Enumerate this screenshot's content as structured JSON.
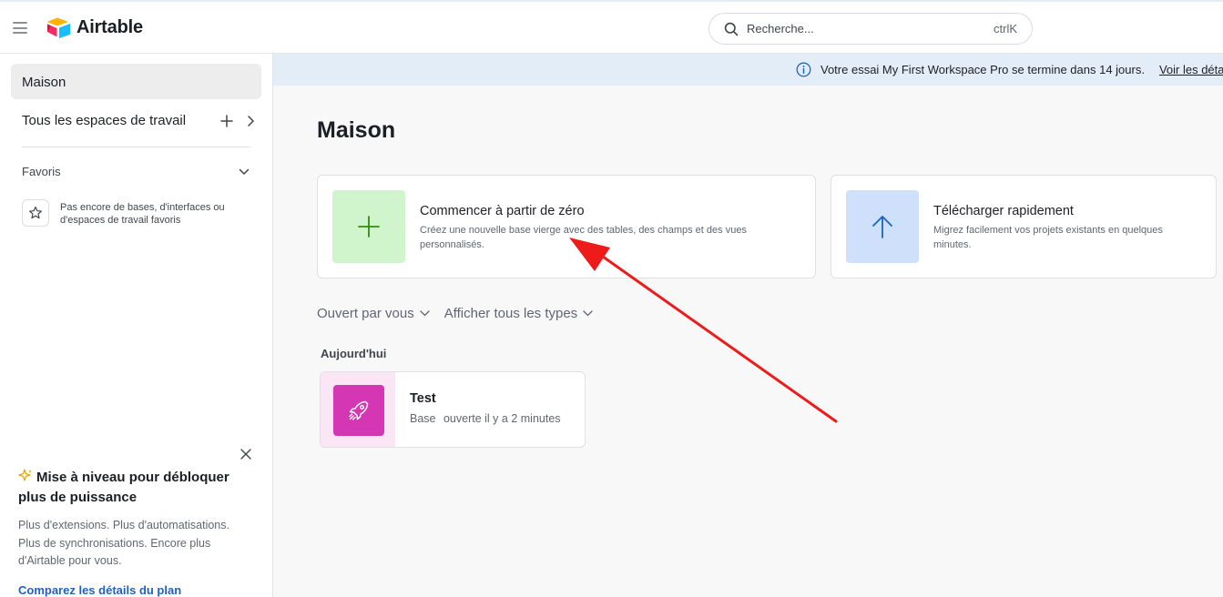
{
  "header": {
    "app_name": "Airtable",
    "search_placeholder": "Recherche...",
    "search_shortcut": "ctrlK"
  },
  "sidebar": {
    "home": "Maison",
    "workspaces": "Tous les espaces de travail",
    "favorites_title": "Favoris",
    "favorites_empty": "Pas encore de bases, d'interfaces ou d'espaces de travail favoris",
    "upgrade": {
      "title": "Mise à niveau pour débloquer plus de puissance",
      "description": "Plus d'extensions. Plus d'automatisations. Plus de synchronisations. Encore plus d'Airtable pour vous.",
      "link": "Comparez les détails du plan"
    }
  },
  "banner": {
    "text": "Votre essai My First Workspace Pro se termine dans 14 jours.",
    "link": "Voir les détails"
  },
  "main": {
    "title": "Maison",
    "cards": [
      {
        "title": "Commencer à partir de zéro",
        "description": "Créez une nouvelle base vierge avec des tables, des champs et des vues personnalisés.",
        "icon": "plus-icon",
        "tile_color": "#d0f4cc",
        "icon_color": "#338a17"
      },
      {
        "title": "Télécharger rapidement",
        "description": "Migrez facilement vos projets existants en quelques minutes.",
        "icon": "arrow-up-icon",
        "tile_color": "#cfe0fb",
        "icon_color": "#1c63c4"
      }
    ],
    "filters": {
      "opened_by": "Ouvert par vous",
      "types": "Afficher tous les types"
    },
    "section_today": "Aujourd'hui",
    "bases": [
      {
        "name": "Test",
        "type": "Base",
        "opened": "ouverte il y a 2 minutes",
        "icon": "rocket-icon",
        "color": "#d536b3"
      }
    ]
  },
  "annotation": {
    "arrow_color": "#ee1b1b"
  }
}
